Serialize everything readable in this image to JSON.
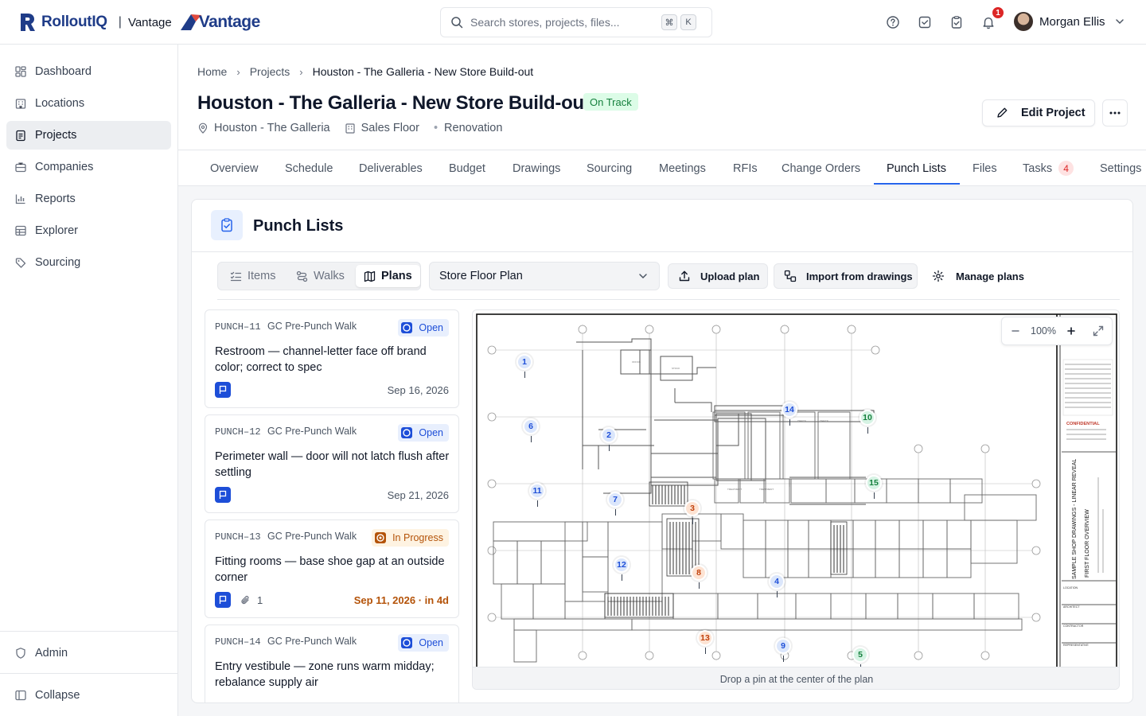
{
  "brand": {
    "name": "RolloutIQ",
    "separator": "|",
    "sub": "Vantage",
    "partner": "Vantage"
  },
  "search": {
    "placeholder": "Search stores, projects, files...",
    "kbd1": "⌘",
    "kbd2": "K"
  },
  "topbar": {
    "notification_count": "1",
    "user_name": "Morgan Ellis"
  },
  "sidebar": {
    "items": [
      {
        "label": "Dashboard",
        "icon": "dashboard-icon"
      },
      {
        "label": "Locations",
        "icon": "building-icon"
      },
      {
        "label": "Projects",
        "icon": "clipboard-icon"
      },
      {
        "label": "Companies",
        "icon": "briefcase-icon"
      },
      {
        "label": "Reports",
        "icon": "bar-chart-icon"
      },
      {
        "label": "Explorer",
        "icon": "table-icon"
      },
      {
        "label": "Sourcing",
        "icon": "tag-icon"
      }
    ],
    "admin": "Admin",
    "collapse": "Collapse"
  },
  "breadcrumb": [
    "Home",
    "Projects",
    "Houston - The Galleria - New Store Build-out"
  ],
  "project": {
    "title": "Houston - The Galleria - New Store Build-out",
    "status": "On Track",
    "location": "Houston - The Galleria",
    "area": "Sales Floor",
    "type": "Renovation",
    "edit_label": "Edit Project"
  },
  "tabs": [
    {
      "label": "Overview"
    },
    {
      "label": "Schedule"
    },
    {
      "label": "Deliverables"
    },
    {
      "label": "Budget"
    },
    {
      "label": "Drawings"
    },
    {
      "label": "Sourcing"
    },
    {
      "label": "Meetings"
    },
    {
      "label": "RFIs"
    },
    {
      "label": "Change Orders"
    },
    {
      "label": "Punch Lists",
      "active": true
    },
    {
      "label": "Files"
    },
    {
      "label": "Tasks",
      "badge": "4"
    },
    {
      "label": "Settings"
    }
  ],
  "punch": {
    "title": "Punch Lists",
    "views": [
      "Items",
      "Walks",
      "Plans"
    ],
    "active_view": "Plans",
    "plan_select": "Store Floor Plan",
    "upload_label": "Upload plan",
    "import_label": "Import from drawings",
    "manage_label": "Manage plans",
    "zoom_value": "100%",
    "footer_hint": "Drop a pin at the center of the plan",
    "items": [
      {
        "id": "PUNCH–11",
        "walk": "GC Pre-Punch Walk",
        "status": "Open",
        "title": "Restroom — channel-letter face off brand color; correct to spec",
        "date": "Sep 16, 2026"
      },
      {
        "id": "PUNCH–12",
        "walk": "GC Pre-Punch Walk",
        "status": "Open",
        "title": "Perimeter wall — door will not latch flush after settling",
        "date": "Sep 21, 2026"
      },
      {
        "id": "PUNCH–13",
        "walk": "GC Pre-Punch Walk",
        "status": "In Progress",
        "title": "Fitting rooms — base shoe gap at an outside corner",
        "attachments": "1",
        "date": "Sep 11, 2026 · in 4d"
      },
      {
        "id": "PUNCH–14",
        "walk": "GC Pre-Punch Walk",
        "status": "Open",
        "title": "Entry vestibule — zone runs warm midday; rebalance supply air",
        "date": ""
      }
    ],
    "pins": [
      "1",
      "2",
      "3",
      "4",
      "5",
      "6",
      "7",
      "8",
      "9",
      "10",
      "11",
      "12",
      "13",
      "14",
      "15"
    ]
  },
  "titleblock": {
    "confidential": "CONFIDENTIAL",
    "project_name": "SAMPLE SHOP DRAWINGS - LINEAR REVEAL",
    "sheet_title": "FIRST FLOOR OVERVIEW",
    "labels": [
      "LOCATION",
      "ARCHITECT",
      "CONTRACTOR",
      "REPRESENTATIVE"
    ]
  },
  "colors": {
    "accent": "#2563eb",
    "brand": "#1f3c88",
    "status_ok": "#15803d",
    "warn": "#b45309",
    "danger": "#dc2626"
  }
}
